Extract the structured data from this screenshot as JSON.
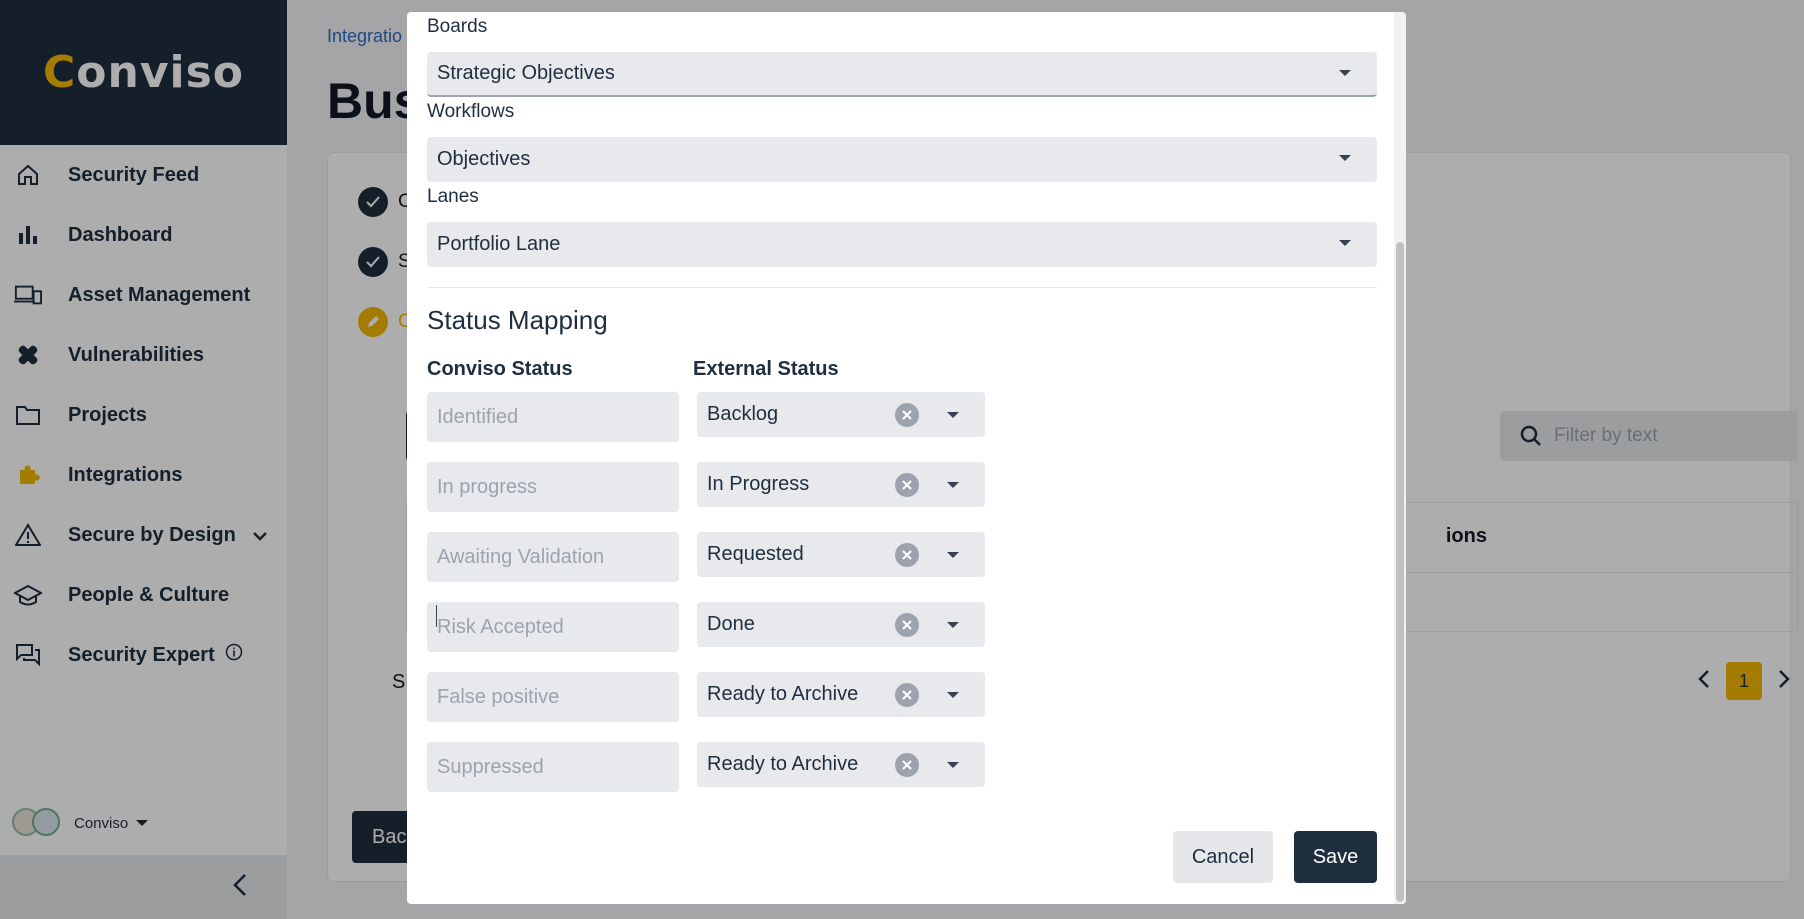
{
  "app": {
    "logo_text": "Conviso"
  },
  "sidebar": {
    "items": [
      {
        "label": "Security Feed",
        "icon": "home-icon"
      },
      {
        "label": "Dashboard",
        "icon": "bar-chart-icon"
      },
      {
        "label": "Asset Management",
        "icon": "devices-icon"
      },
      {
        "label": "Vulnerabilities",
        "icon": "bandage-icon"
      },
      {
        "label": "Projects",
        "icon": "folder-icon"
      },
      {
        "label": "Integrations",
        "icon": "puzzle-icon",
        "active": true
      },
      {
        "label": "Secure by Design",
        "icon": "warning-icon"
      },
      {
        "label": "People & Culture",
        "icon": "graduation-cap-icon"
      },
      {
        "label": "Security Expert",
        "icon": "chat-icon"
      }
    ],
    "org_name": "Conviso"
  },
  "page": {
    "breadcrumb": "Integratio",
    "title": "Bus",
    "filter_placeholder": "Filter by text",
    "table_col": "ions",
    "page_number": "1",
    "back_label": "Bac",
    "step_letters": [
      "C",
      "S",
      "C"
    ],
    "s_letter": "S"
  },
  "modal": {
    "boards_label": "Boards",
    "boards_value": "Strategic Objectives",
    "workflows_label": "Workflows",
    "workflows_value": "Objectives",
    "lanes_label": "Lanes",
    "lanes_value": "Portfolio Lane",
    "section_title": "Status Mapping",
    "col_conviso": "Conviso Status",
    "col_external": "External Status",
    "mappings": [
      {
        "conviso": "Identified",
        "external": "Backlog"
      },
      {
        "conviso": "In progress",
        "external": "In Progress"
      },
      {
        "conviso": "Awaiting Validation",
        "external": "Requested"
      },
      {
        "conviso": "Risk Accepted",
        "external": "Done"
      },
      {
        "conviso": "False positive",
        "external": "Ready to Archive"
      },
      {
        "conviso": "Suppressed",
        "external": "Ready to Archive"
      }
    ],
    "cancel_label": "Cancel",
    "save_label": "Save"
  },
  "colors": {
    "brand_dark": "#1f2e3f",
    "accent": "#f2b705",
    "link": "#2d6cc0"
  }
}
